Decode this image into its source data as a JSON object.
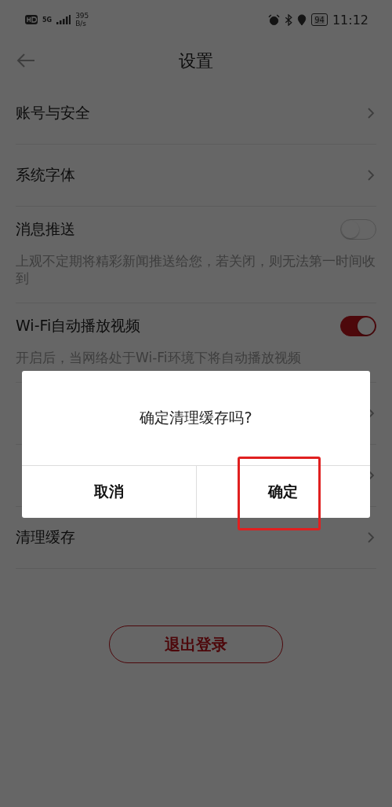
{
  "status_bar": {
    "network_type": "5G",
    "speed_value": "395",
    "speed_unit": "B/s",
    "battery": "94",
    "time": "11:12"
  },
  "header": {
    "title": "设置"
  },
  "settings": [
    {
      "kind": "link",
      "label": "账号与安全"
    },
    {
      "kind": "link",
      "label": "系统字体"
    },
    {
      "kind": "toggle",
      "label": "消息推送",
      "on": false,
      "description": "上观不定期将精彩新闻推送给您，若关闭，则无法第一时间收到"
    },
    {
      "kind": "toggle",
      "label": "Wi-Fi自动播放视频",
      "on": true,
      "description": "开启后，当网络处于Wi-Fi环境下将自动播放视频"
    },
    {
      "kind": "link"
    },
    {
      "kind": "link"
    },
    {
      "kind": "link",
      "label": "清理缓存"
    }
  ],
  "logout_button": "退出登录",
  "dialog": {
    "message": "确定清理缓存吗?",
    "buttons": [
      {
        "label": "取消",
        "highlighted": false
      },
      {
        "label": "确定",
        "highlighted": true
      }
    ]
  }
}
